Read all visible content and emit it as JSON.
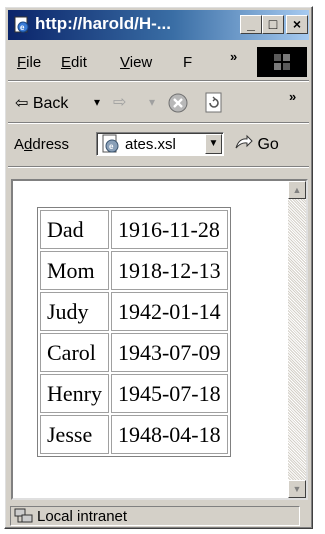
{
  "window": {
    "title": "http://harold/H-...",
    "controls": {
      "minimize": "_",
      "maximize": "□",
      "close": "×"
    }
  },
  "menubar": {
    "items": [
      {
        "label": "File",
        "accel": "F",
        "rest": "ile"
      },
      {
        "label": "Edit",
        "accel": "E",
        "rest": "dit"
      },
      {
        "label": "View",
        "accel": "V",
        "rest": "iew"
      },
      {
        "label": "F",
        "accel": "F",
        "rest": ""
      }
    ],
    "overflow": "»"
  },
  "toolbar": {
    "back_label": "Back",
    "back_arrow": "⇦",
    "forward_arrow": "⇨",
    "dropdown_caret": "▾",
    "overflow": "»"
  },
  "address": {
    "label_accel": "d",
    "label_pre": "A",
    "label_post": "dress",
    "value": "ates.xsl",
    "go_label": "Go"
  },
  "table": {
    "rows": [
      {
        "name": "Dad",
        "date": "1916-11-28"
      },
      {
        "name": "Mom",
        "date": "1918-12-13"
      },
      {
        "name": "Judy",
        "date": "1942-01-14"
      },
      {
        "name": "Carol",
        "date": "1943-07-09"
      },
      {
        "name": "Henry",
        "date": "1945-07-18"
      },
      {
        "name": "Jesse",
        "date": "1948-04-18"
      }
    ]
  },
  "status": {
    "zone": "Local intranet"
  },
  "icons": {
    "title": "ie-page-icon",
    "stop": "stop-icon",
    "refresh": "refresh-icon",
    "page": "page-icon",
    "go": "go-arrow-icon",
    "zone": "local-intranet-icon"
  }
}
